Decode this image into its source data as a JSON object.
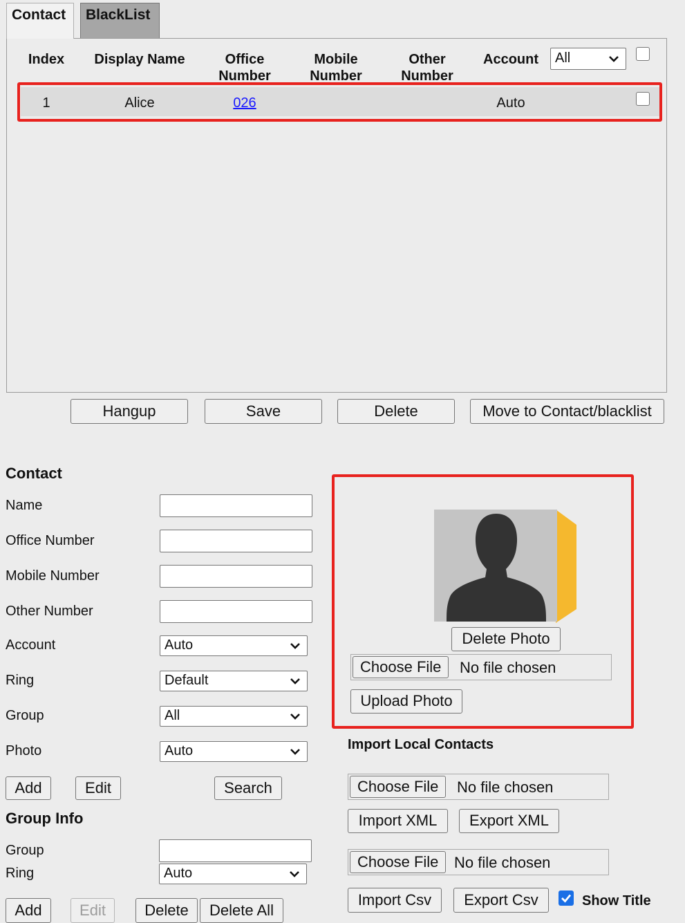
{
  "tabs": [
    {
      "label": "Contact",
      "active": true
    },
    {
      "label": "BlackList",
      "active": false
    }
  ],
  "table": {
    "headers": {
      "index": "Index",
      "display_name": "Display Name",
      "office_line1": "Office",
      "office_line2": "Number",
      "mobile_line1": "Mobile",
      "mobile_line2": "Number",
      "other_line1": "Other",
      "other_line2": "Number",
      "account": "Account"
    },
    "account_filter": "All",
    "rows": [
      {
        "index": "1",
        "display_name": "Alice",
        "office_number": "026",
        "mobile_number": "",
        "other_number": "",
        "account": "Auto"
      }
    ]
  },
  "actions": {
    "hangup": "Hangup",
    "save": "Save",
    "delete": "Delete",
    "move": "Move to Contact/blacklist"
  },
  "contact_form": {
    "title": "Contact",
    "name_label": "Name",
    "office_label": "Office Number",
    "mobile_label": "Mobile Number",
    "other_label": "Other Number",
    "account_label": "Account",
    "account_value": "Auto",
    "ring_label": "Ring",
    "ring_value": "Default",
    "group_label": "Group",
    "group_value": "All",
    "photo_label": "Photo",
    "photo_value": "Auto",
    "add": "Add",
    "edit": "Edit",
    "search": "Search"
  },
  "group_info": {
    "title": "Group Info",
    "group_label": "Group",
    "ring_label": "Ring",
    "ring_value": "Auto",
    "add": "Add",
    "edit": "Edit",
    "delete": "Delete",
    "delete_all": "Delete All"
  },
  "photo_panel": {
    "delete_photo": "Delete Photo",
    "choose_file": "Choose File",
    "no_file": "No file chosen",
    "upload_photo": "Upload Photo"
  },
  "import_panel": {
    "title": "Import Local Contacts",
    "choose_file": "Choose File",
    "no_file": "No file chosen",
    "import_xml": "Import XML",
    "export_xml": "Export XML",
    "import_csv": "Import Csv",
    "export_csv": "Export Csv",
    "show_title": "Show Title",
    "show_title_checked": true
  },
  "colors": {
    "highlight_border": "#e8221e",
    "avatar_card": "#f5b82e",
    "link": "#1a1aff"
  }
}
